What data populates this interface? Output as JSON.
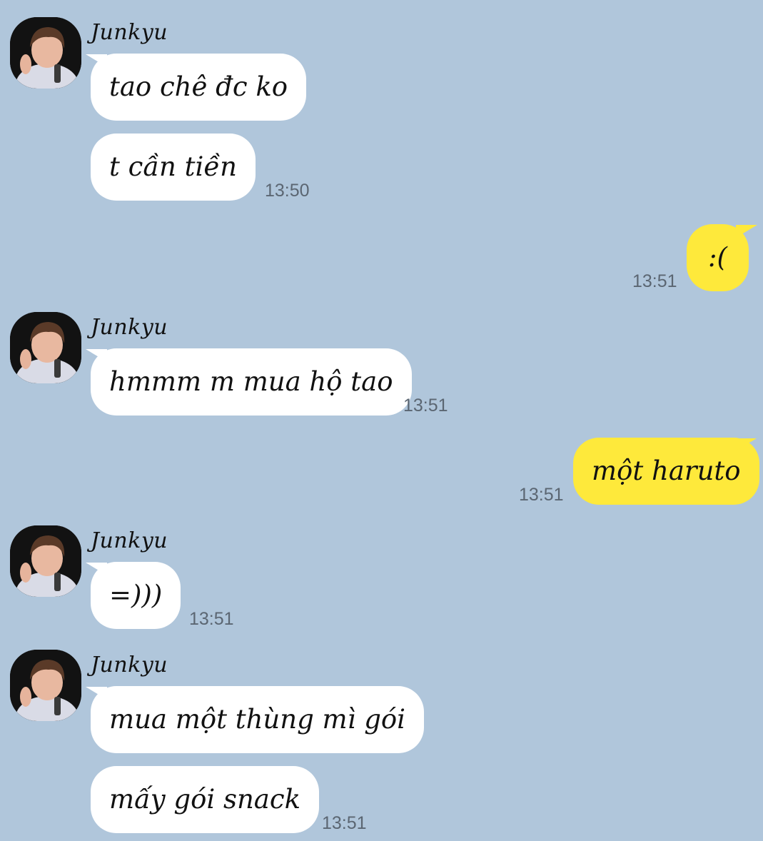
{
  "chat": {
    "groups": [
      {
        "sender": "Junkyu",
        "messages": [
          "tao chê đc ko",
          "t cần tiền"
        ],
        "time": "13:50"
      },
      {
        "outgoing": [
          ":("
        ],
        "time": "13:51"
      },
      {
        "sender": "Junkyu",
        "messages": [
          "hmmm m mua hộ tao"
        ],
        "time": "13:51"
      },
      {
        "outgoing": [
          "một haruto"
        ],
        "time": "13:51"
      },
      {
        "sender": "Junkyu",
        "messages": [
          "=)))"
        ],
        "time": "13:51"
      },
      {
        "sender": "Junkyu",
        "messages": [
          "mua một thùng mì gói",
          "mấy gói snack"
        ],
        "time": "13:51"
      }
    ]
  },
  "colors": {
    "background": "#b0c6db",
    "incoming_bubble": "#ffffff",
    "outgoing_bubble": "#fee93b",
    "timestamp": "#5b6672"
  }
}
